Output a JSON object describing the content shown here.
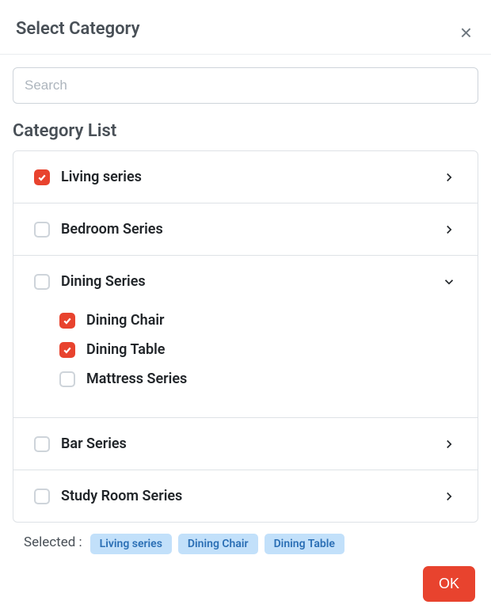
{
  "modal": {
    "title": "Select Category",
    "searchPlaceholder": "Search",
    "listTitle": "Category List",
    "selectedLabel": "Selected :",
    "okLabel": "OK"
  },
  "categories": [
    {
      "label": "Living series",
      "checked": true,
      "expanded": false,
      "children": []
    },
    {
      "label": "Bedroom Series",
      "checked": false,
      "expanded": false,
      "children": []
    },
    {
      "label": "Dining Series",
      "checked": false,
      "expanded": true,
      "children": [
        {
          "label": "Dining Chair",
          "checked": true
        },
        {
          "label": "Dining Table",
          "checked": true
        },
        {
          "label": "Mattress Series",
          "checked": false
        }
      ]
    },
    {
      "label": "Bar Series",
      "checked": false,
      "expanded": false,
      "children": []
    },
    {
      "label": "Study Room Series",
      "checked": false,
      "expanded": false,
      "children": []
    }
  ],
  "selectedTags": [
    "Living series",
    "Dining Chair",
    "Dining Table"
  ]
}
